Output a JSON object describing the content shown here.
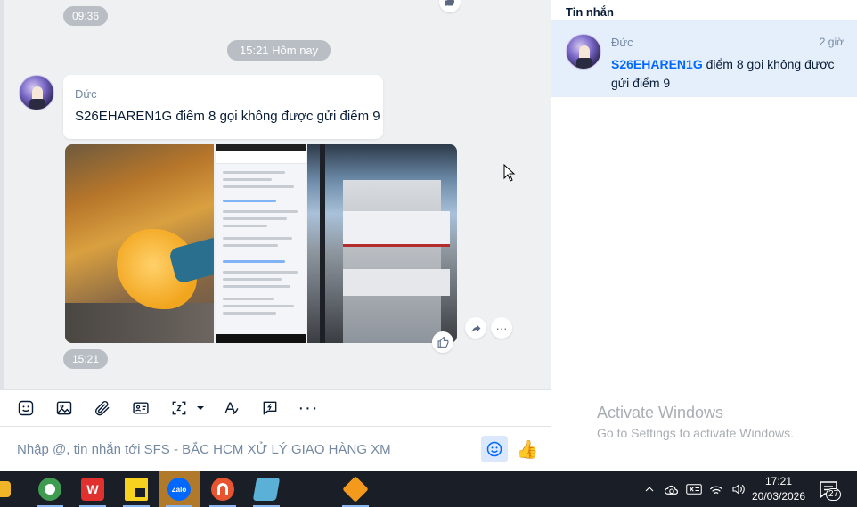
{
  "chat": {
    "time_top": "09:36",
    "date_separator": "15:21 Hôm nay",
    "message": {
      "sender": "Đức",
      "text": "S26EHAREN1G điểm 8 gọi không được gửi điểm 9",
      "time": "15:21"
    },
    "image_icons": [
      "like-icon",
      "share-icon",
      "more-icon"
    ]
  },
  "toolbar": {
    "tools": [
      "sticker-icon",
      "image-icon",
      "attachment-icon",
      "contact-card-icon",
      "screenshot-icon",
      "dropdown-caret-icon",
      "text-format-icon",
      "quick-message-icon",
      "more-icon"
    ],
    "more_label": "···"
  },
  "composer": {
    "placeholder": "Nhập @, tin nhắn tới SFS - BẮC HCM XỬ LÝ GIAO HÀNG XM",
    "emoji_icon": "emoji-icon",
    "send_like_icon": "thumbs-up-icon",
    "thumb_glyph": "👍"
  },
  "right_panel": {
    "title": "Tin nhắn",
    "conversation": {
      "sender": "Đức",
      "time": "2 giờ",
      "preview_code": "S26EHAREN1G",
      "preview_rest": " điểm 8 gọi không được gửi điểm 9"
    },
    "watermark": {
      "title": "Activate Windows",
      "subtitle": "Go to Settings to activate Windows."
    }
  },
  "taskbar": {
    "apps": [
      {
        "name": "file-explorer",
        "color": "#f0b429"
      },
      {
        "name": "coc-coc-browser",
        "color": "#3e9b4f"
      },
      {
        "name": "wps-office",
        "color": "#e0312e",
        "label": "W"
      },
      {
        "name": "sticky-notes",
        "color": "#f7d21e"
      },
      {
        "name": "sublime-app",
        "color": "#f28b1f"
      },
      {
        "name": "zalo",
        "color": "#0068ff",
        "label": "Zalo"
      },
      {
        "name": "ultraviewer",
        "color": "#e8542f"
      },
      {
        "name": "notes-app",
        "color": "#5bb0d8"
      },
      {
        "name": "package-app",
        "color": "#f39a1d"
      }
    ],
    "clock_time": "17:21",
    "clock_date": "20/03/2026",
    "notification_count": "27",
    "tray_icons": [
      "chevron-up-icon",
      "onedrive-icon",
      "keyboard-lang-icon",
      "wifi-icon",
      "volume-icon"
    ]
  }
}
